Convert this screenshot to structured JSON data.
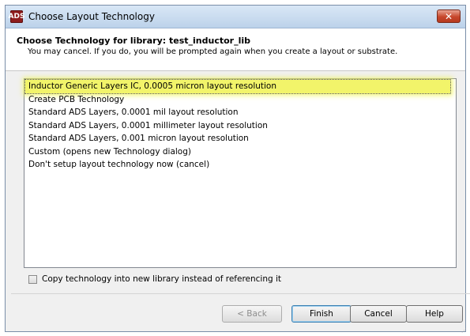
{
  "window": {
    "title": "Choose Layout Technology",
    "icon_text": "ADS",
    "close_glyph": "✕"
  },
  "header": {
    "title": "Choose Technology for library: test_inductor_lib",
    "subtitle": "You may cancel.  If you do, you will be prompted again when you create a layout or substrate."
  },
  "list": {
    "selected_index": 0,
    "highlight_color": "#f2f46a",
    "items": [
      {
        "label": "Inductor Generic Layers IC, 0.0005 micron layout resolution"
      },
      {
        "label": "Create PCB Technology"
      },
      {
        "label": "Standard ADS Layers, 0.0001 mil layout resolution"
      },
      {
        "label": "Standard ADS Layers, 0.0001 millimeter layout resolution"
      },
      {
        "label": "Standard ADS Layers, 0.001 micron layout resolution"
      },
      {
        "label": "Custom (opens new Technology dialog)"
      },
      {
        "label": "Don't setup layout technology now (cancel)"
      }
    ]
  },
  "copy_option": {
    "label": "Copy technology into new library instead of referencing it",
    "checked": false
  },
  "buttons": {
    "back": "< Back",
    "finish": "Finish",
    "cancel": "Cancel",
    "help": "Help"
  }
}
